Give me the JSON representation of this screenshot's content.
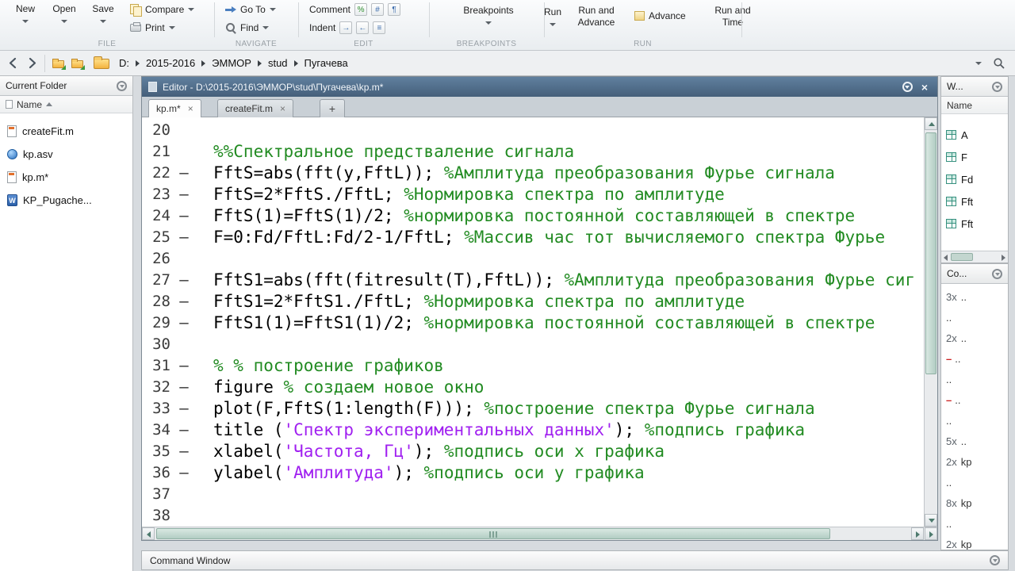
{
  "colors": {
    "code": "#000000",
    "comment": "#228b22",
    "string": "#a020f0",
    "error": "#cc2222"
  },
  "icons": {
    "close": "×",
    "plus": "+",
    "exec_dash": "–",
    "error_dash": "–",
    "comment_glyphs": [
      "%",
      "#",
      "¶"
    ],
    "indent_glyphs": [
      "→",
      "←",
      "≡"
    ]
  },
  "ribbon": {
    "file": {
      "section": "FILE",
      "new": "New",
      "open": "Open",
      "save": "Save",
      "compare": "Compare",
      "print": "Print"
    },
    "navigate": {
      "section": "NAVIGATE",
      "go_to": "Go To",
      "find": "Find"
    },
    "edit": {
      "section": "EDIT",
      "comment": "Comment",
      "indent": "Indent"
    },
    "breakpoints": {
      "section": "BREAKPOINTS",
      "button": "Breakpoints"
    },
    "run": {
      "section": "RUN",
      "run": "Run",
      "run_and_advance_1": "Run and",
      "run_and_advance_2": "Advance",
      "advance": "Advance",
      "run_and_time_1": "Run and",
      "run_and_time_2": "Time"
    }
  },
  "address_bar": {
    "path": [
      "D:",
      "2015-2016",
      "ЭММОР",
      "stud",
      "Пугачева"
    ]
  },
  "current_folder": {
    "title": "Current Folder",
    "name_column": "Name",
    "files": [
      {
        "name": "createFit.m",
        "icon": "mfile"
      },
      {
        "name": "kp.asv",
        "icon": "asv"
      },
      {
        "name": "kp.m*",
        "icon": "mfile"
      },
      {
        "name": "KP_Pugache...",
        "icon": "doc"
      }
    ]
  },
  "editor": {
    "title": "Editor - D:\\2015-2016\\ЭММОР\\stud\\Пугачева\\kp.m*",
    "tabs": [
      {
        "label": "kp.m*",
        "active": true
      },
      {
        "label": "createFit.m",
        "active": false
      }
    ],
    "new_tab": "+",
    "lines": [
      {
        "n": 20,
        "dash": false,
        "tokens": []
      },
      {
        "n": 21,
        "dash": false,
        "tokens": [
          {
            "t": "%%Спектральное предстваление сигнала",
            "k": "comment"
          }
        ]
      },
      {
        "n": 22,
        "dash": true,
        "tokens": [
          {
            "t": "FftS=abs(fft(y,FftL)); ",
            "k": "code"
          },
          {
            "t": "%Амплитуда преобразования Фурье сигнала",
            "k": "comment"
          }
        ]
      },
      {
        "n": 23,
        "dash": true,
        "tokens": [
          {
            "t": "FftS=2*FftS./FftL; ",
            "k": "code"
          },
          {
            "t": "%Нормировка спектра по амплитуде",
            "k": "comment"
          }
        ]
      },
      {
        "n": 24,
        "dash": true,
        "tokens": [
          {
            "t": "FftS(1)=FftS(1)/2; ",
            "k": "code"
          },
          {
            "t": "%нормировка постоянной составляющей в спектре",
            "k": "comment"
          }
        ]
      },
      {
        "n": 25,
        "dash": true,
        "tokens": [
          {
            "t": "F=0:Fd/FftL:Fd/2-1/FftL; ",
            "k": "code"
          },
          {
            "t": "%Массив час тот вычисляемого спектра Фурье",
            "k": "comment"
          }
        ]
      },
      {
        "n": 26,
        "dash": false,
        "tokens": []
      },
      {
        "n": 27,
        "dash": true,
        "tokens": [
          {
            "t": "FftS1=abs(fft(fitresult(T),FftL)); ",
            "k": "code"
          },
          {
            "t": "%Амплитуда преобразования Фурье сиг",
            "k": "comment"
          }
        ]
      },
      {
        "n": 28,
        "dash": true,
        "tokens": [
          {
            "t": "FftS1=2*FftS1./FftL; ",
            "k": "code"
          },
          {
            "t": "%Нормировка спектра по амплитуде",
            "k": "comment"
          }
        ]
      },
      {
        "n": 29,
        "dash": true,
        "tokens": [
          {
            "t": "FftS1(1)=FftS1(1)/2; ",
            "k": "code"
          },
          {
            "t": "%нормировка постоянной составляющей в спектре",
            "k": "comment"
          }
        ]
      },
      {
        "n": 30,
        "dash": false,
        "tokens": []
      },
      {
        "n": 31,
        "dash": true,
        "tokens": [
          {
            "t": "% % построение графиков",
            "k": "comment"
          }
        ]
      },
      {
        "n": 32,
        "dash": true,
        "tokens": [
          {
            "t": "figure ",
            "k": "code"
          },
          {
            "t": "% создаем новое окно",
            "k": "comment"
          }
        ]
      },
      {
        "n": 33,
        "dash": true,
        "tokens": [
          {
            "t": "plot(F,FftS(1:length(F))); ",
            "k": "code"
          },
          {
            "t": "%построение спектра Фурье сигнала",
            "k": "comment"
          }
        ]
      },
      {
        "n": 34,
        "dash": true,
        "tokens": [
          {
            "t": "title (",
            "k": "code"
          },
          {
            "t": "'Спектр экспериментальных данных'",
            "k": "string"
          },
          {
            "t": "); ",
            "k": "code"
          },
          {
            "t": "%подпись графика",
            "k": "comment"
          }
        ]
      },
      {
        "n": 35,
        "dash": true,
        "tokens": [
          {
            "t": "xlabel(",
            "k": "code"
          },
          {
            "t": "'Частота, Гц'",
            "k": "string"
          },
          {
            "t": "); ",
            "k": "code"
          },
          {
            "t": "%подпись оси x графика",
            "k": "comment"
          }
        ]
      },
      {
        "n": 36,
        "dash": true,
        "tokens": [
          {
            "t": "ylabel(",
            "k": "code"
          },
          {
            "t": "'Амплитуда'",
            "k": "string"
          },
          {
            "t": "); ",
            "k": "code"
          },
          {
            "t": "%подпись оси y графика",
            "k": "comment"
          }
        ]
      },
      {
        "n": 37,
        "dash": false,
        "tokens": []
      },
      {
        "n": 38,
        "dash": false,
        "tokens": []
      }
    ]
  },
  "workspace": {
    "title": "W...",
    "name_column": "Name",
    "variables": [
      "A",
      "F",
      "Fd",
      "Fft",
      "Fft"
    ]
  },
  "command_history": {
    "title": "Co...",
    "entries": [
      {
        "count": "3x",
        "text": ".."
      },
      {
        "text": ".."
      },
      {
        "count": "2x",
        "text": ".."
      },
      {
        "error": true,
        "text": ".."
      },
      {
        "text": ".."
      },
      {
        "error": true,
        "text": ".."
      },
      {
        "text": ".."
      },
      {
        "count": "5x",
        "text": ".."
      },
      {
        "count": "2x",
        "text": "kp"
      },
      {
        "text": ".."
      },
      {
        "count": "8x",
        "text": "kp"
      },
      {
        "text": ".."
      },
      {
        "count": "2x",
        "text": "kp"
      }
    ]
  },
  "command_window": {
    "title": "Command Window"
  }
}
